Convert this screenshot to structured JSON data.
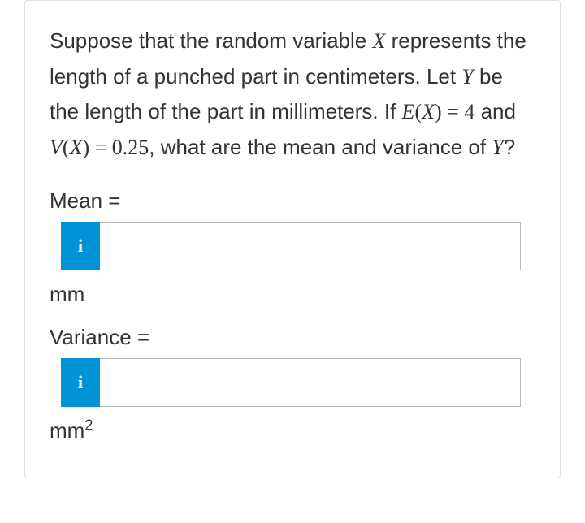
{
  "question": {
    "intro": "Suppose that the random variable ",
    "var_x": "X",
    "mid1": " represents the length of a punched part in centimeters. Let ",
    "var_y": "Y",
    "mid2": " be the length of the part in millimeters. If ",
    "ex_func": "E",
    "ex_open": "(",
    "ex_var": "X",
    "ex_close": ")",
    "ex_eq": " = 4",
    "mid3": " and ",
    "vx_func": "V",
    "vx_open": "(",
    "vx_var": "X",
    "vx_close": ")",
    "vx_eq": " = 0.25",
    "mid4": ", what are the mean and variance of ",
    "var_y2": "Y",
    "end": "?"
  },
  "fields": {
    "mean": {
      "label": "Mean =",
      "unit": "mm",
      "value": ""
    },
    "variance": {
      "label": "Variance =",
      "unit_base": "mm",
      "unit_exp": "2",
      "value": ""
    }
  },
  "icons": {
    "info": "i"
  }
}
